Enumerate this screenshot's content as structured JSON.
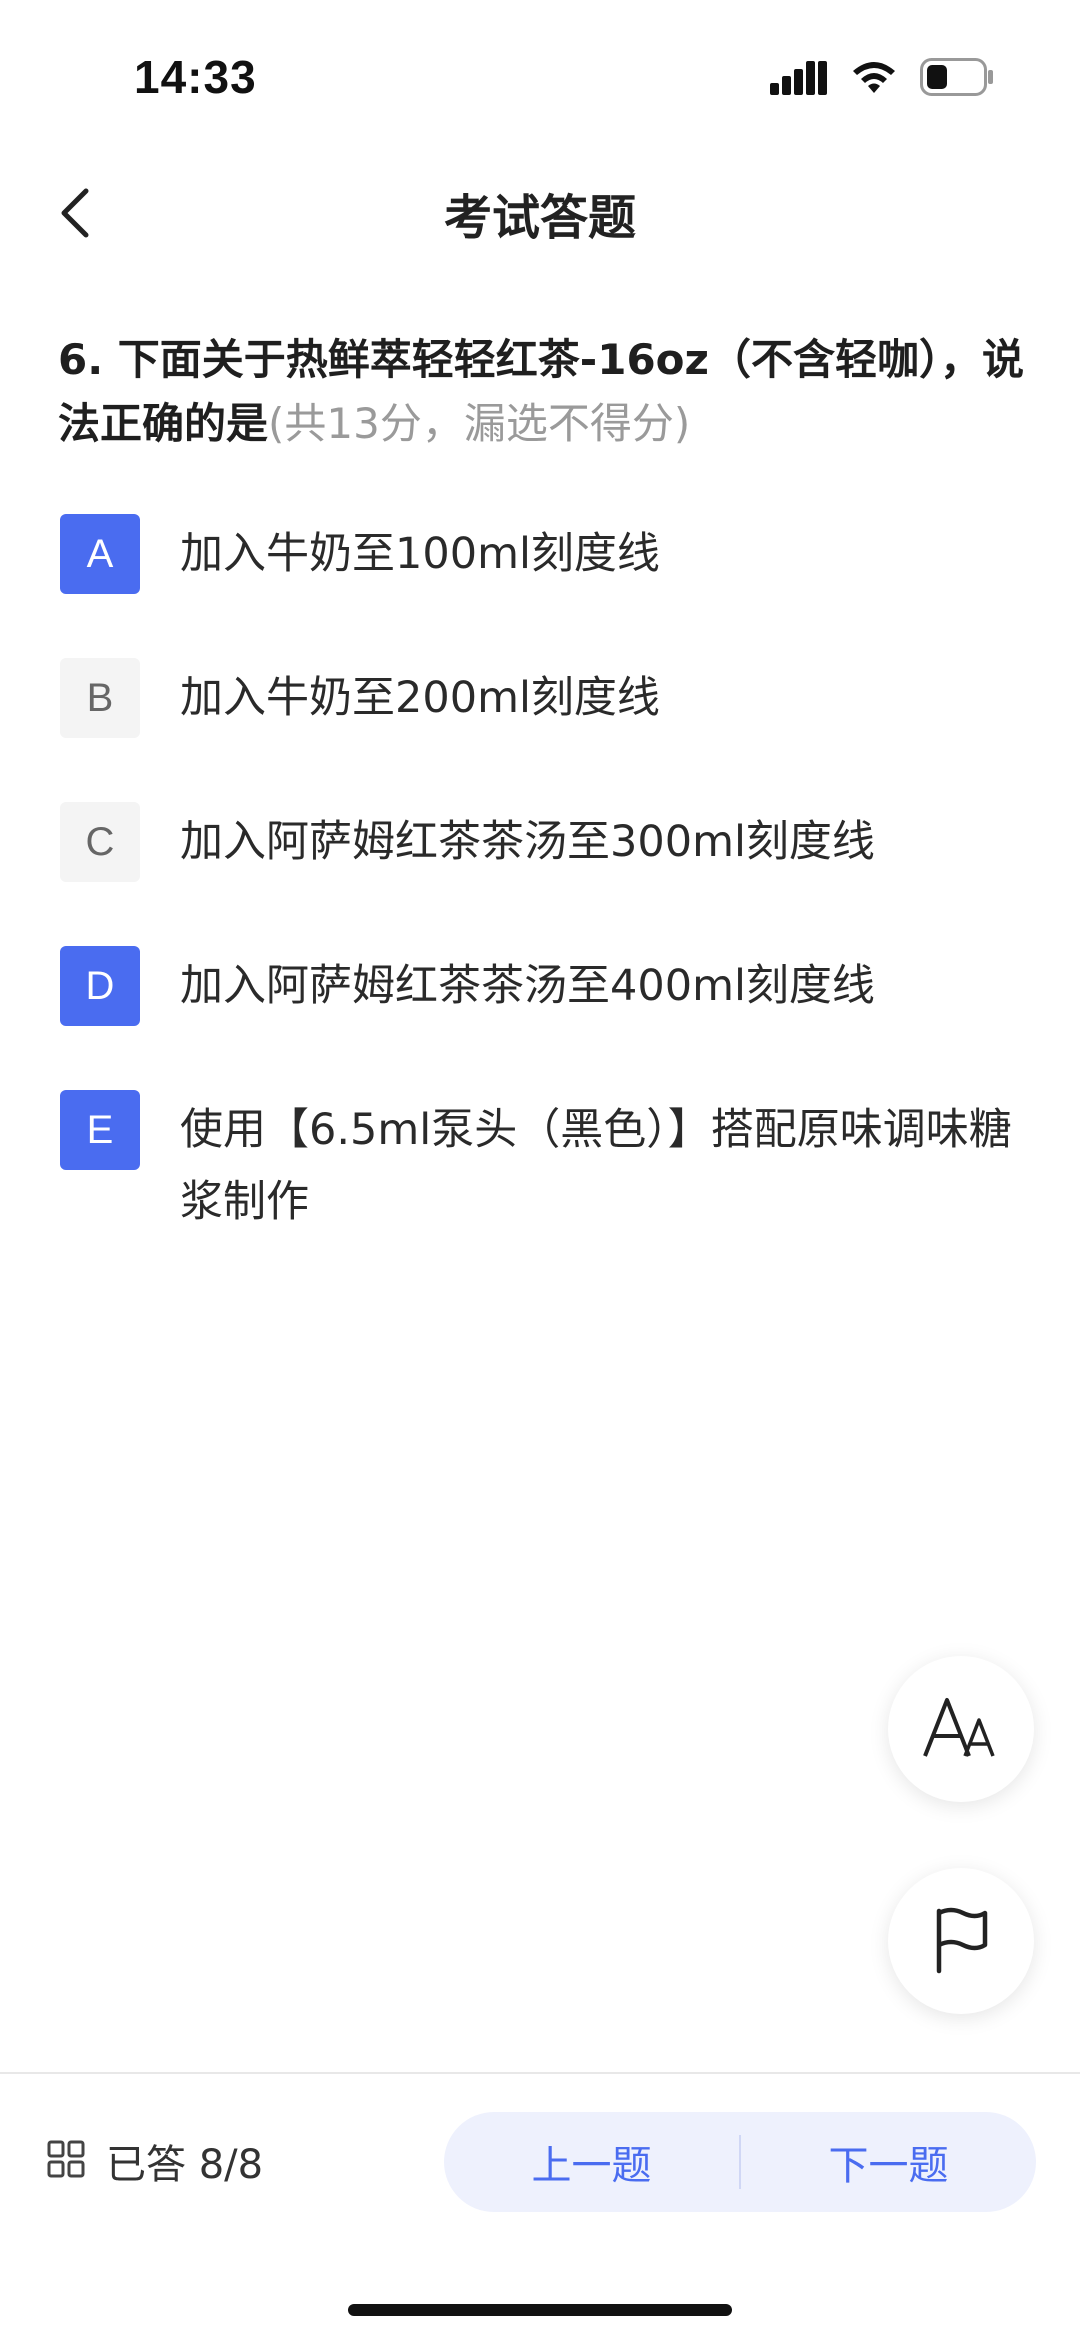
{
  "status_bar": {
    "time": "14:33"
  },
  "header": {
    "title": "考试答题"
  },
  "question": {
    "text": "6. 下面关于热鲜萃轻轻红茶-16oz（不含轻咖），说法正确的是",
    "note": "(共13分，漏选不得分)"
  },
  "options": [
    {
      "letter": "A",
      "text": "加入牛奶至100ml刻度线",
      "selected": true
    },
    {
      "letter": "B",
      "text": "加入牛奶至200ml刻度线",
      "selected": false
    },
    {
      "letter": "C",
      "text": "加入阿萨姆红茶茶汤至300ml刻度线",
      "selected": false
    },
    {
      "letter": "D",
      "text": "加入阿萨姆红茶茶汤至400ml刻度线",
      "selected": true
    },
    {
      "letter": "E",
      "text": "使用【6.5ml泵头（黑色）】搭配原味调味糖浆制作",
      "selected": true
    }
  ],
  "floating": {
    "font_size_icon": "font-size-icon",
    "flag_icon": "flag-icon"
  },
  "bottom_bar": {
    "answered_label": "已答 8/8",
    "prev_label": "上一题",
    "next_label": "下一题"
  },
  "colors": {
    "accent": "#4a6cf0",
    "unselected_bg": "#f4f4f4",
    "pill_bg": "#eef1fd"
  }
}
